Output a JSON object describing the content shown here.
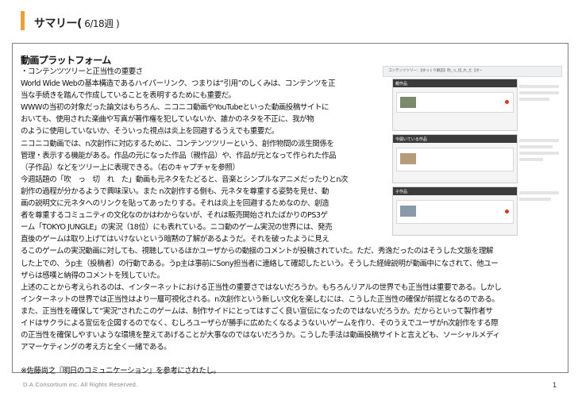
{
  "slide": {
    "title_main": "サマリー(",
    "title_sub": " 6/18週 )",
    "heading": "動画プラットフォーム",
    "body_lines": [
      "・コンテンツツリーと正当性の重要さ",
      "World Wide Webの基本構造であるハイパーリンク、つまりは“引用”のしくみは、コンテンツを正",
      "当な手続きを踏んで作成していることを表明するためにも重要だ。",
      "WWWの当初の対象だった論文はもちろん、ニコニコ動画やYouTubeといった動画投稿サイトに",
      "おいても、使用された楽曲や写真が著作権を犯していないか、誰かのネタを不正に、我が物",
      "のように使用していないか、そういった視点は炎上を回避するうえでも重要だ。",
      "ニコニコ動画では、n次創作に対応するために、コンテンツツリーという、創作物間の派生関係を",
      "管理・表示する機能がある。作品の元になった作品（親作品）や、作品が元となって作られた作品",
      "（子作品）などをツリー上に表現できる。（右のキャプチャを参照）",
      "今週話題の「吹　っ　切　れ　た」動画も元ネタをたどると、音楽とシンプルなアニメだったりとn次",
      "創作の過程が分かるようで興味深い。また n次創作する側も、元ネタを尊重する姿勢を見せ、動",
      "画の説明文に元ネタへのリンクを貼ってあったりする。それは炎上を回避するためなのか、創造",
      "者を尊重するコミュニティの文化なのかはわからないが、それは販売開始されたばかりのPS3ゲ",
      "ーム「TOKYO JUNGLE」の実況（18位）にも表れている。ニコ動のゲーム実況の世界には、発売",
      "直後のゲームは取り上げてはいけないという暗黙の了解があるようだ。それを破ったように見え",
      "るこのゲームの実況動画に対しても、視聴しているほかユーザからの動揺のコメントが投稿されていた。ただ、秀逸だったのはそうした文脈を理解",
      "した上での、うp主（投稿者）の行動である。うp主は事前にSony担当者に連絡して確認したという。そうした経緯説明が動画中になされて、他ユー",
      "ザらは感嘆と納得のコメントを残していた。",
      "上述のことから考えられるのは、インターネットにおける正当性の重要さではないだろうか。もちろんリアルの世界でも正当性は重要である。しかし",
      "インターネットの世界では正当性はより一層可視化される。n次創作という新しい文化を楽しむには、こうした正当性の確保が前提となるのである。",
      "また、正当性を確保して“実況”されたこのゲームは、制作サイドにとってはすごく良い宣伝になったのではないだろうか。だからといって製作者サ",
      "イドはサクラによる宣伝を企図するのでなく、むしろユーザらが勝手に広めたくなるようないいゲームを作り、そのうえでユーザがn次創作をする際",
      "の正当性を確保しやすいような環境を整えてあげることが大事なのではないだろうか。こうした手法は動画投稿サイトと言えども、ソーシャルメディ",
      "アマーケティングの考え方と全く一緒である。",
      "",
      "※佐藤尚之『明日のコミュニケーション』を参考にされたし。"
    ],
    "footer": "D.A.Consortium inc. All Rights Reserved.",
    "page_number": "1"
  },
  "screenshot": {
    "tab_label": "コンテンツツリー：【ゆっくり解説】吹_っ_切_れ_た【オーストラリア改訂版】",
    "parent_label": "親作品",
    "current_label": "今開いている作品",
    "child_label": "子作品"
  }
}
